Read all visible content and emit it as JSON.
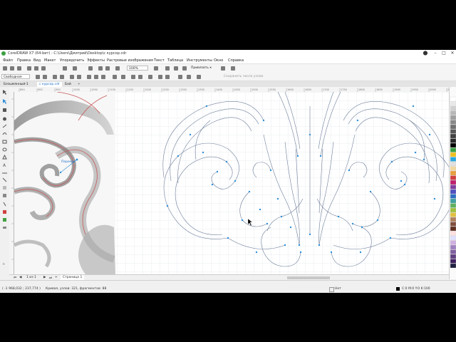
{
  "window": {
    "title": "CorelDRAW X7 (64-bит) - C:\\Users\\Дмитрий\\Desktop\\с курсор.cdr"
  },
  "menu": [
    "Файл",
    "Правка",
    "Вид",
    "Макет",
    "Упорядочить",
    "Эффекты",
    "Растровые изображения",
    "Текст",
    "Таблица",
    "Инструменты",
    "Окно",
    "Справка"
  ],
  "toolbar": {
    "zoom": "100%",
    "snap_label": "Привязать к",
    "node_text": "Сохранить числа узлов"
  },
  "propbar": {
    "mode": "Свободная"
  },
  "tabs": [
    "Безымянный-1",
    "с курсор.cdr",
    "Бой"
  ],
  "active_tab": 1,
  "canvas": {
    "tooltip": "Перенос"
  },
  "pagebar": {
    "page_count": "1 из 1",
    "page_tab": "Страница 1"
  },
  "status": {
    "coords": "( -1 968,032 ; 237,774 )",
    "info": "Кривая, узлов: 321, фрагментов: 88",
    "fill": "Нет",
    "outline": "C:0 M:0 Y:0 K:100"
  },
  "ruler_marks": [
    "850",
    "900",
    "950",
    "1000",
    "1050",
    "1100",
    "1150",
    "1200",
    "1250",
    "1300",
    "1350",
    "1400",
    "1450",
    "1500",
    "1550",
    "1600",
    "1650",
    "1700",
    "1750",
    "1800",
    "1850",
    "1900",
    "1950",
    "2000",
    "2050"
  ],
  "colors": {
    "accent": "#1a6fc9",
    "curve": "#6e7e9a",
    "node": "#2f8fd8",
    "sketch_line": "#c85a5a",
    "palette": [
      "#ffffff",
      "#e8e8e8",
      "#d0d0d0",
      "#b8b8b8",
      "#a0a0a0",
      "#888888",
      "#707070",
      "#585858",
      "#404040",
      "#282828",
      "#000000",
      "#3aa142",
      "#f0c020",
      "#2aa8e0",
      "#e0e0e0",
      "#f2d7a0",
      "#e8a040",
      "#d04040",
      "#c02070",
      "#8040a0",
      "#5050c0",
      "#3070c0",
      "#40a0a0",
      "#60b060",
      "#a0c040",
      "#e0c040",
      "#b08060",
      "#805040",
      "#603020",
      "#ffe0e0",
      "#e0e0ff",
      "#d0b0e0",
      "#a080c0",
      "#8060a0",
      "#604080",
      "#402060",
      "#202040"
    ]
  }
}
